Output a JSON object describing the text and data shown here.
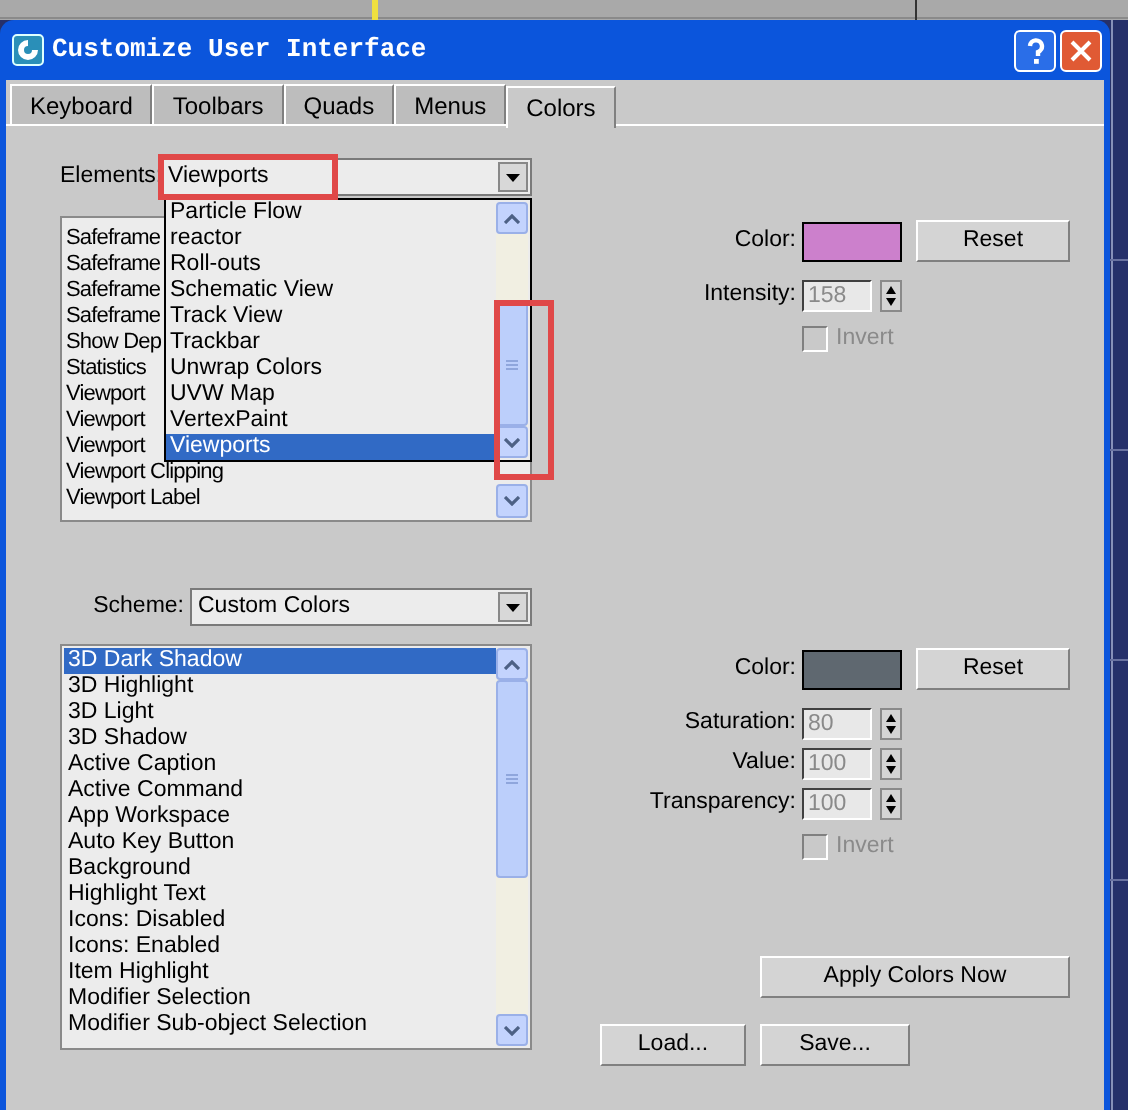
{
  "window": {
    "title": "Customize User Interface"
  },
  "tabs": [
    {
      "label": "Keyboard",
      "selected": false
    },
    {
      "label": "Toolbars",
      "selected": false
    },
    {
      "label": "Quads",
      "selected": false
    },
    {
      "label": "Menus",
      "selected": false
    },
    {
      "label": "Colors",
      "selected": true
    }
  ],
  "elements": {
    "label": "Elements:",
    "value": "Viewports",
    "list": [
      "Safeframe",
      "Safeframe",
      "Safeframe",
      "Safeframe",
      "Show Dep",
      "Statistics",
      "Viewport",
      "Viewport",
      "Viewport",
      "Viewport Clipping",
      "Viewport Label"
    ],
    "dropdown": {
      "expanded": true,
      "options": [
        {
          "label": "Particle Flow",
          "selected": false
        },
        {
          "label": "reactor",
          "selected": false
        },
        {
          "label": "Roll-outs",
          "selected": false
        },
        {
          "label": "Schematic View",
          "selected": false
        },
        {
          "label": "Track View",
          "selected": false
        },
        {
          "label": "Trackbar",
          "selected": false
        },
        {
          "label": "Unwrap Colors",
          "selected": false
        },
        {
          "label": "UVW Map",
          "selected": false
        },
        {
          "label": "VertexPaint",
          "selected": false
        },
        {
          "label": "Viewports",
          "selected": true
        }
      ]
    }
  },
  "element_color": {
    "label": "Color:",
    "color": "#cc80cc",
    "reset": "Reset",
    "fields": [
      {
        "label": "Intensity:",
        "value": "158",
        "disabled": true
      }
    ],
    "invert": {
      "label": "Invert",
      "checked": false,
      "disabled": true
    }
  },
  "scheme": {
    "label": "Scheme:",
    "value": "Custom Colors",
    "items": [
      {
        "label": "3D Dark Shadow",
        "selected": true
      },
      {
        "label": "3D Highlight",
        "selected": false
      },
      {
        "label": "3D Light",
        "selected": false
      },
      {
        "label": "3D Shadow",
        "selected": false
      },
      {
        "label": "Active Caption",
        "selected": false
      },
      {
        "label": "Active Command",
        "selected": false
      },
      {
        "label": "App Workspace",
        "selected": false
      },
      {
        "label": "Auto Key Button",
        "selected": false
      },
      {
        "label": "Background",
        "selected": false
      },
      {
        "label": "Highlight Text",
        "selected": false
      },
      {
        "label": "Icons: Disabled",
        "selected": false
      },
      {
        "label": "Icons: Enabled",
        "selected": false
      },
      {
        "label": "Item Highlight",
        "selected": false
      },
      {
        "label": "Modifier Selection",
        "selected": false
      },
      {
        "label": "Modifier Sub-object Selection",
        "selected": false
      }
    ]
  },
  "scheme_color": {
    "label": "Color:",
    "color": "#5f6870",
    "reset": "Reset",
    "fields": [
      {
        "label": "Saturation:",
        "value": "80",
        "disabled": true
      },
      {
        "label": "Value:",
        "value": "100",
        "disabled": true
      },
      {
        "label": "Transparency:",
        "value": "100",
        "disabled": true
      }
    ],
    "invert": {
      "label": "Invert",
      "checked": false,
      "disabled": true
    }
  },
  "buttons": {
    "apply": "Apply Colors Now",
    "load": "Load...",
    "save": "Save..."
  }
}
